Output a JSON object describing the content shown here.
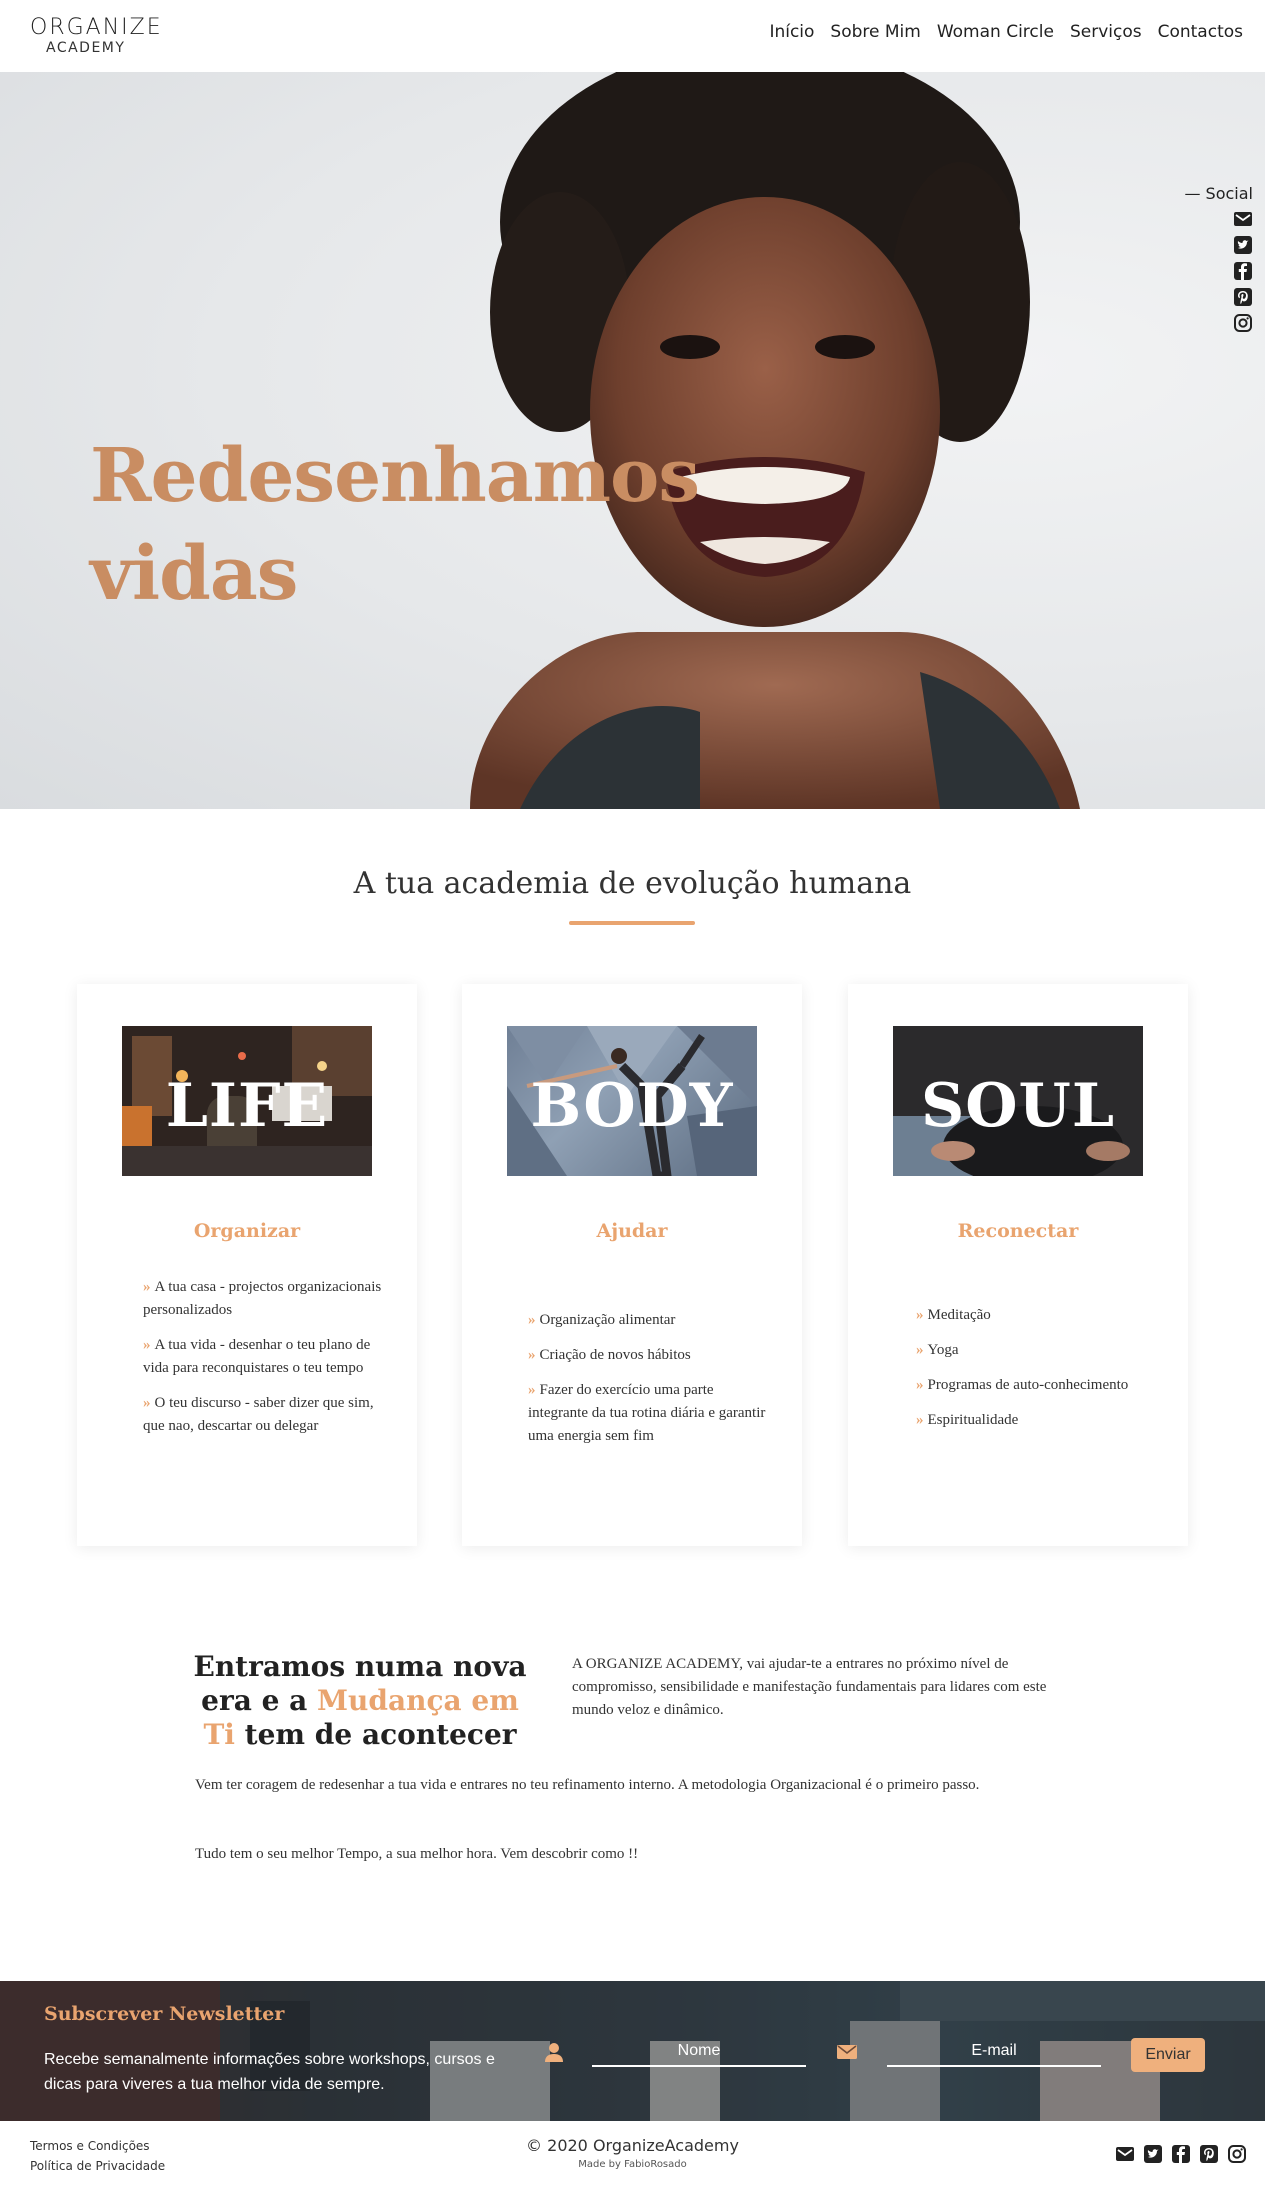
{
  "nav": {
    "logo_line1": "ORGANIZE",
    "logo_line2": "ACADEMY",
    "items": [
      "Início",
      "Sobre Mim",
      "Woman Circle",
      "Serviços",
      "Contactos"
    ]
  },
  "hero": {
    "title_line1": "Redesenhamos",
    "title_line2": "vidas",
    "social_label": "— Social",
    "social_icons": [
      "email-icon",
      "twitter-icon",
      "facebook-icon",
      "pinterest-icon",
      "instagram-icon"
    ]
  },
  "section": {
    "title": "A tua academia de evolução humana"
  },
  "cards": [
    {
      "image_word": "LIFE",
      "title": "Organizar",
      "items": [
        "A tua casa - projectos organizacionais personalizados",
        "A tua vida - desenhar o teu plano de vida para reconquistares o teu tempo",
        "O teu discurso - saber dizer que sim, que nao, descartar ou delegar"
      ]
    },
    {
      "image_word": "BODY",
      "title": "Ajudar",
      "items": [
        "Organização alimentar",
        "Criação de novos hábitos",
        "Fazer do exercício uma parte integrante da tua rotina diária e garantir uma energia sem fim"
      ]
    },
    {
      "image_word": "SOUL",
      "title": "Reconectar",
      "items": [
        "Meditação",
        "Yoga",
        "Programas de auto-conhecimento",
        "Espiritualidade"
      ]
    }
  ],
  "middle": {
    "heading_part1": "Entramos numa nova era e a ",
    "heading_accent": "Mudança em Ti",
    "heading_part2": " tem de acontecer",
    "right_text": "A ORGANIZE ACADEMY, vai ajudar-te a entrares no próximo nível de compromisso, sensibilidade e manifestação fundamentais para lidares com este mundo veloz e dinâmico.",
    "paragraph1": "Vem ter coragem de redesenhar a tua vida e entrares no teu refinamento interno. A metodologia Organizacional é o primeiro passo.",
    "paragraph2": "Tudo tem o seu melhor Tempo, a sua melhor hora. Vem descobrir como !!"
  },
  "newsletter": {
    "title": "Subscrever Newsletter",
    "text": "Recebe semanalmente informações sobre workshops, cursos e dicas para viveres a tua melhor vida de sempre.",
    "name_placeholder": "Nome",
    "email_placeholder": "E-mail",
    "send_label": "Enviar"
  },
  "footer": {
    "terms": "Termos e Condições",
    "privacy": "Política de Privacidade",
    "copyright": "© 2020 OrganizeAcademy",
    "made_by": "Made by FabioRosado"
  },
  "colors": {
    "accent": "#e9a46f",
    "hero_title": "#c98d62",
    "text": "#333333"
  }
}
